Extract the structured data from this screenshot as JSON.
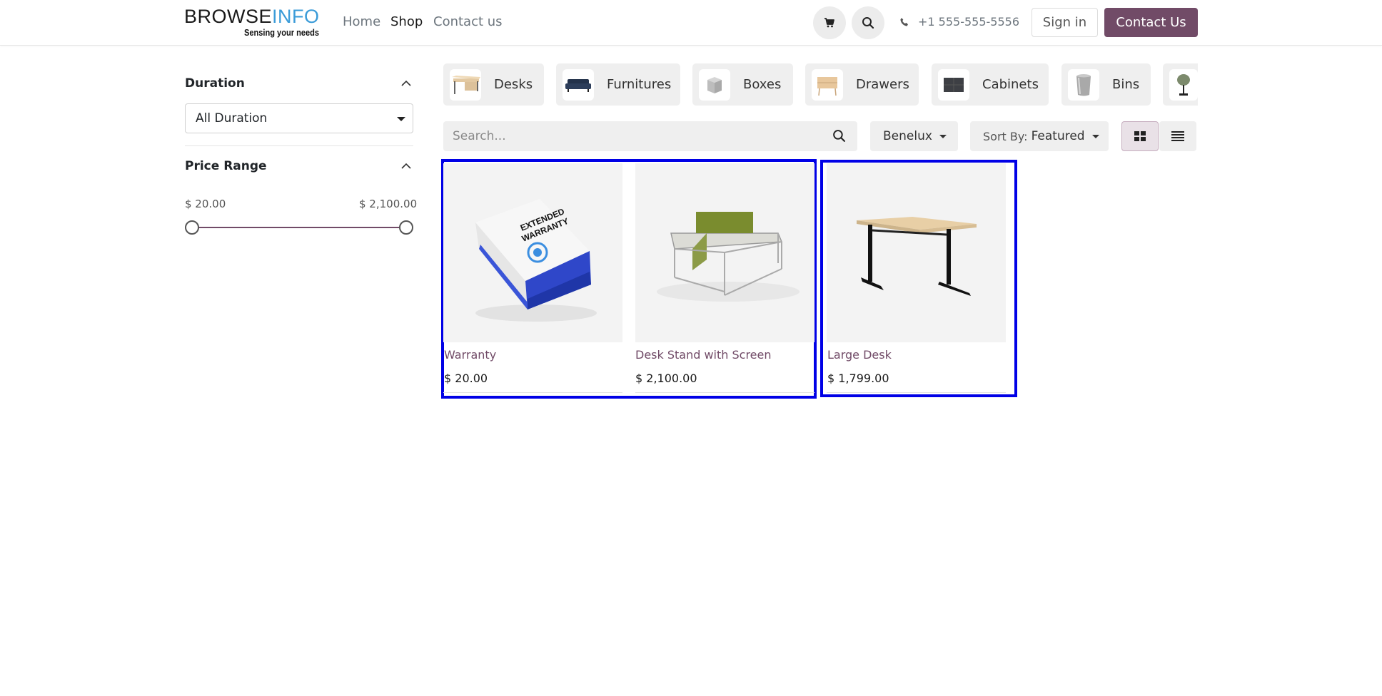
{
  "header": {
    "logo": {
      "part1": "BROWSE",
      "part2": "INFO",
      "tagline": "Sensing your needs"
    },
    "nav": {
      "home": "Home",
      "shop": "Shop",
      "contact": "Contact us"
    },
    "phone": "+1 555-555-5556",
    "sign_in": "Sign in",
    "contact_button": "Contact Us",
    "icons": {
      "cart": "cart-icon",
      "search": "search-icon",
      "phone": "phone-icon"
    }
  },
  "sidebar": {
    "duration": {
      "title": "Duration",
      "selected": "All Duration"
    },
    "price_range": {
      "title": "Price Range",
      "min": "$ 20.00",
      "max": "$ 2,100.00",
      "range_low_fraction": 0.0,
      "range_high_fraction": 1.0
    }
  },
  "categories": [
    {
      "label": "Desks"
    },
    {
      "label": "Furnitures"
    },
    {
      "label": "Boxes"
    },
    {
      "label": "Drawers"
    },
    {
      "label": "Cabinets"
    },
    {
      "label": "Bins"
    }
  ],
  "toolbar": {
    "search_placeholder": "Search...",
    "pricelist": "Benelux",
    "sort_prefix": "Sort By:",
    "sort_value": "Featured"
  },
  "products": [
    {
      "name": "Warranty",
      "price": "$ 20.00"
    },
    {
      "name": "Desk Stand with Screen",
      "price": "$ 2,100.00"
    },
    {
      "name": "Large Desk",
      "price": "$ 1,799.00"
    }
  ],
  "colors": {
    "brand": "#714b67",
    "highlight": "#0000e6",
    "logo_accent": "#3a9bd8"
  },
  "warranty_box_text": [
    "EXTENDED",
    "WARRANTY"
  ]
}
